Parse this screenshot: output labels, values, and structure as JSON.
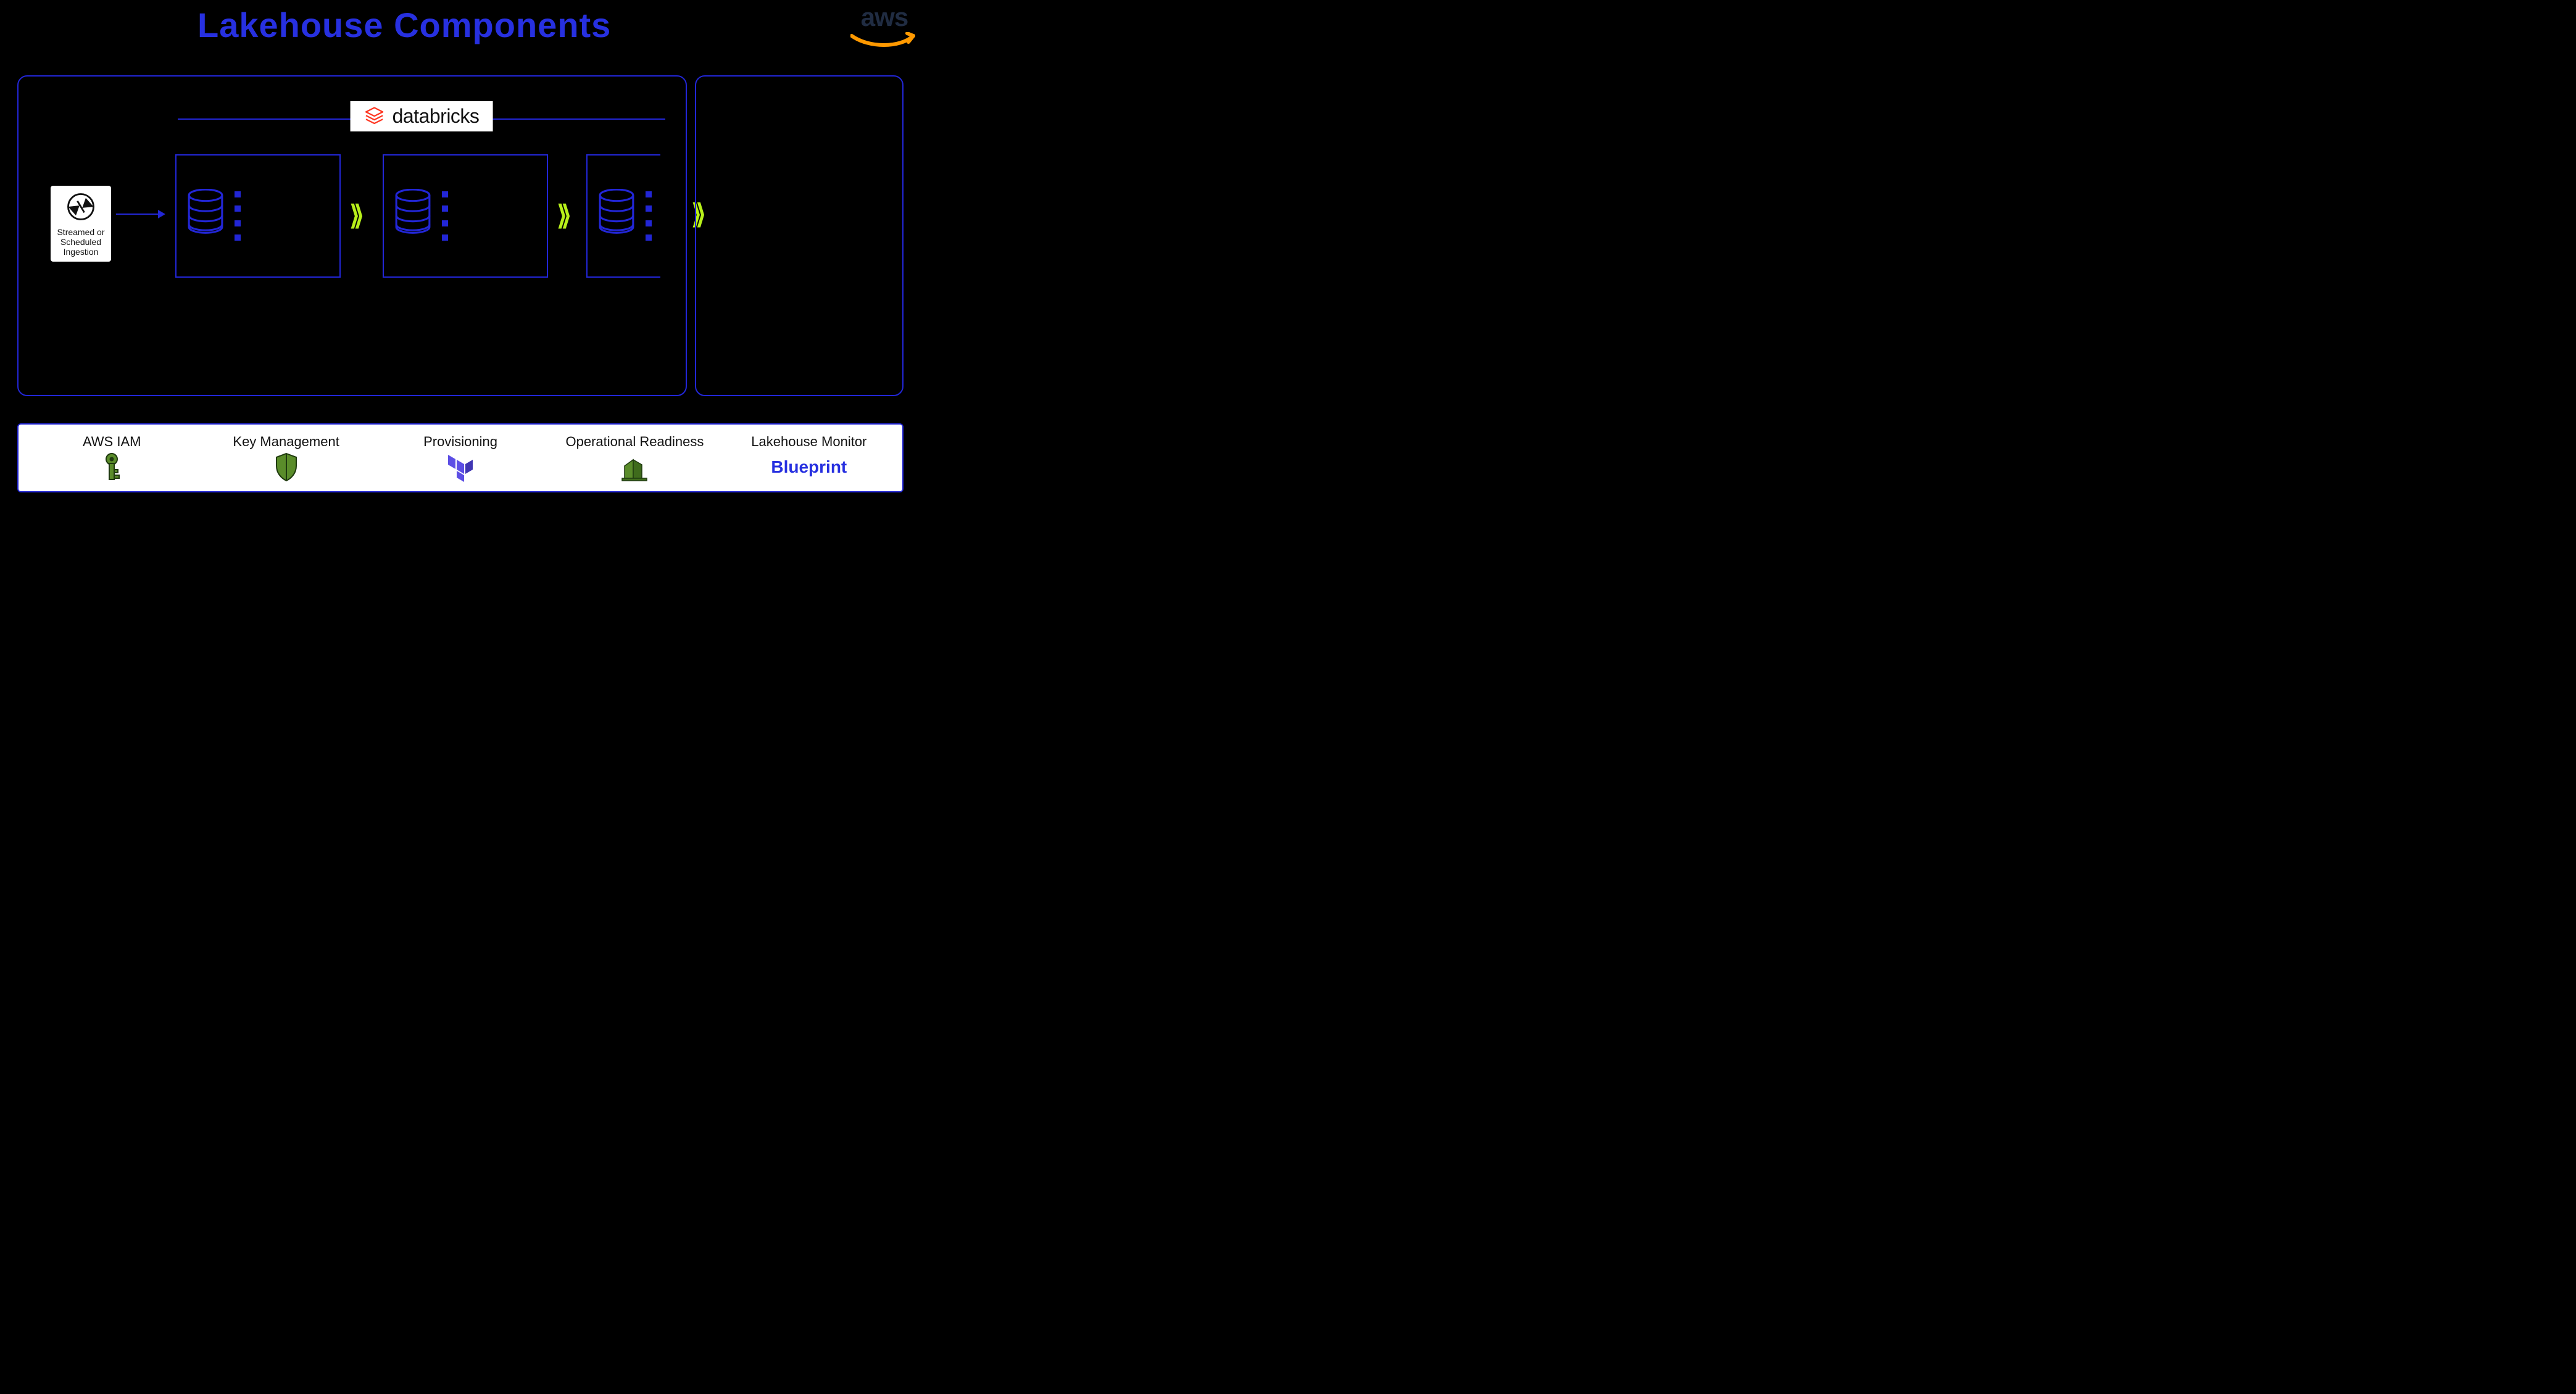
{
  "title": "Lakehouse Components",
  "cloud_logo": "aws",
  "platform_logo": "databricks",
  "ingestion": {
    "label": "Streamed or Scheduled Ingestion"
  },
  "services": {
    "iam": {
      "label": "AWS IAM"
    },
    "kms": {
      "label": "Key Management"
    },
    "prov": {
      "label": "Provisioning"
    },
    "ops": {
      "label": "Operational Readiness"
    },
    "monitor": {
      "label": "Lakehouse Monitor",
      "brand": "Blueprint"
    }
  },
  "colors": {
    "accent": "#2730e0",
    "box_border": "#2226d6",
    "chevron": "#b7f01a",
    "aws_orange": "#ff9900"
  }
}
